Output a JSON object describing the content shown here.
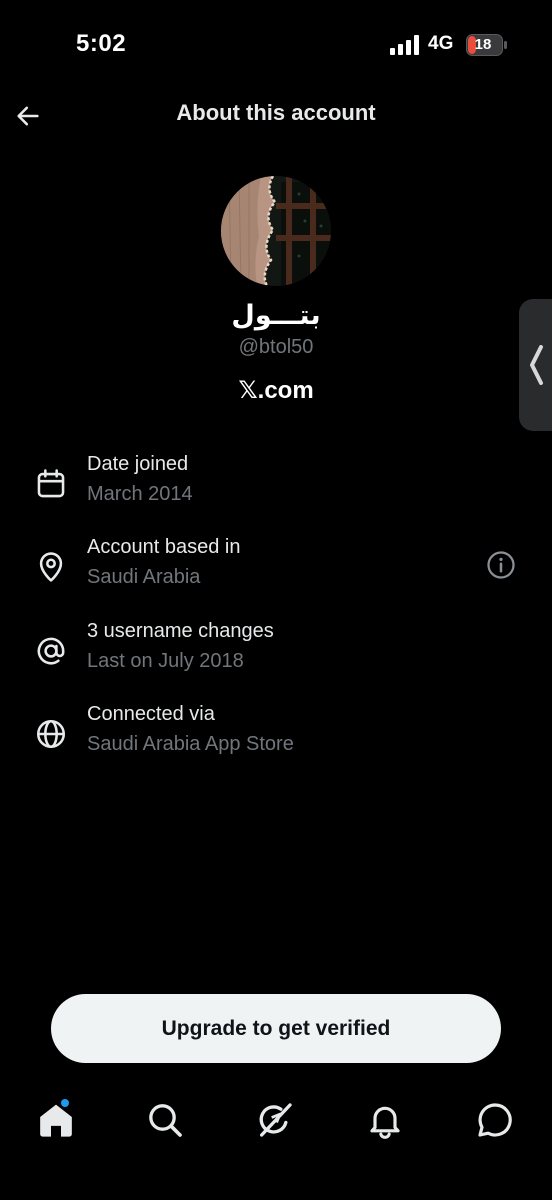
{
  "status_bar": {
    "time": "5:02",
    "network": "4G",
    "battery_level": "18",
    "signal_icon": "cellular-signal-icon",
    "battery_icon": "battery-icon",
    "battery_color": "#eb4d3d"
  },
  "header": {
    "back_icon": "arrow-left-icon",
    "title": "About this account"
  },
  "profile": {
    "display_name": "بتـــول",
    "handle": "@btol50",
    "platform": "𝕏.com"
  },
  "side_tab": {
    "icon": "chevron-left-icon"
  },
  "details": [
    {
      "icon": "calendar-icon",
      "label": "Date joined",
      "value": "March 2014"
    },
    {
      "icon": "location-pin-icon",
      "label": "Account based in",
      "value": "Saudi Arabia",
      "action_icon": "info-icon"
    },
    {
      "icon": "at-sign-icon",
      "label": "3 username changes",
      "value": "Last on July 2018"
    },
    {
      "icon": "globe-icon",
      "label": "Connected via",
      "value": "Saudi Arabia App Store"
    }
  ],
  "upgrade": {
    "label": "Upgrade to get verified"
  },
  "bottom_nav": [
    {
      "icon": "home-icon",
      "active": true,
      "has_notification_dot": true
    },
    {
      "icon": "search-icon"
    },
    {
      "icon": "grok-icon"
    },
    {
      "icon": "bell-icon"
    },
    {
      "icon": "messages-icon"
    }
  ],
  "colors": {
    "background": "#000000",
    "primary_text": "#e7e9ea",
    "secondary_text": "#71767b",
    "accent_dot": "#1d9bf0",
    "button_bg": "#eff3f4"
  }
}
